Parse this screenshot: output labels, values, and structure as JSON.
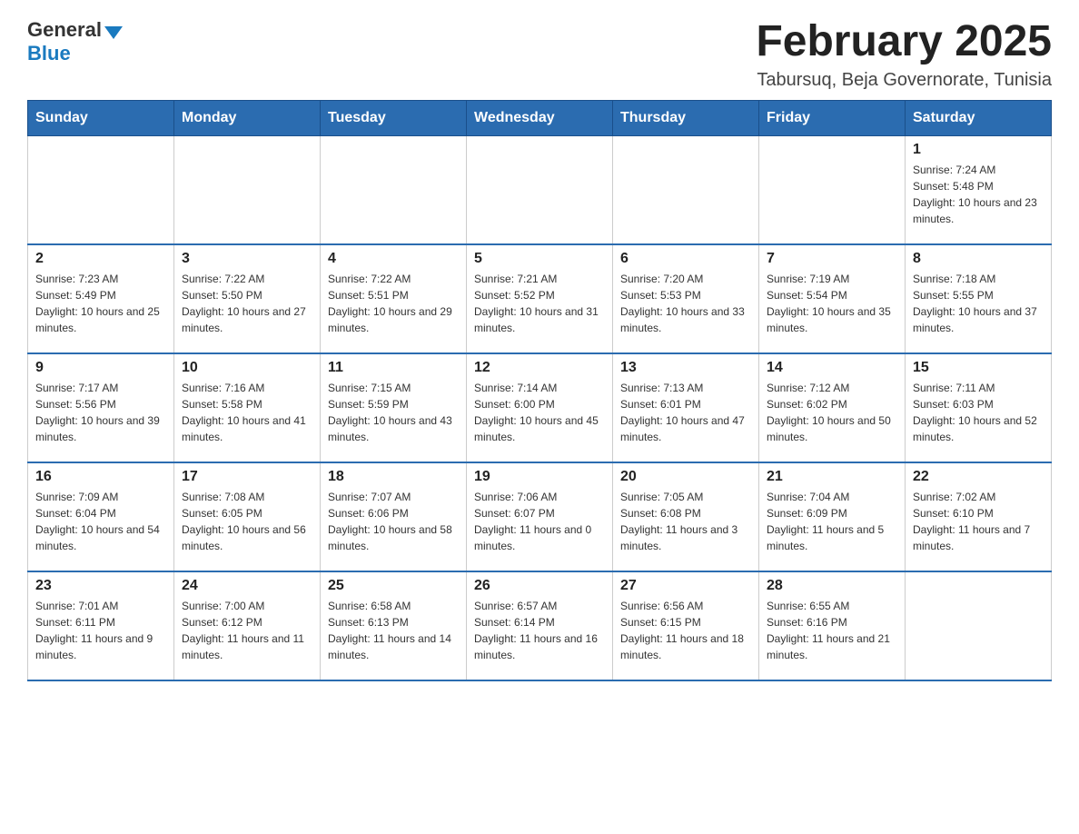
{
  "header": {
    "logo_general": "General",
    "logo_blue": "Blue",
    "month_title": "February 2025",
    "location": "Tabursuq, Beja Governorate, Tunisia"
  },
  "weekdays": [
    "Sunday",
    "Monday",
    "Tuesday",
    "Wednesday",
    "Thursday",
    "Friday",
    "Saturday"
  ],
  "weeks": [
    [
      {
        "day": "",
        "info": ""
      },
      {
        "day": "",
        "info": ""
      },
      {
        "day": "",
        "info": ""
      },
      {
        "day": "",
        "info": ""
      },
      {
        "day": "",
        "info": ""
      },
      {
        "day": "",
        "info": ""
      },
      {
        "day": "1",
        "info": "Sunrise: 7:24 AM\nSunset: 5:48 PM\nDaylight: 10 hours and 23 minutes."
      }
    ],
    [
      {
        "day": "2",
        "info": "Sunrise: 7:23 AM\nSunset: 5:49 PM\nDaylight: 10 hours and 25 minutes."
      },
      {
        "day": "3",
        "info": "Sunrise: 7:22 AM\nSunset: 5:50 PM\nDaylight: 10 hours and 27 minutes."
      },
      {
        "day": "4",
        "info": "Sunrise: 7:22 AM\nSunset: 5:51 PM\nDaylight: 10 hours and 29 minutes."
      },
      {
        "day": "5",
        "info": "Sunrise: 7:21 AM\nSunset: 5:52 PM\nDaylight: 10 hours and 31 minutes."
      },
      {
        "day": "6",
        "info": "Sunrise: 7:20 AM\nSunset: 5:53 PM\nDaylight: 10 hours and 33 minutes."
      },
      {
        "day": "7",
        "info": "Sunrise: 7:19 AM\nSunset: 5:54 PM\nDaylight: 10 hours and 35 minutes."
      },
      {
        "day": "8",
        "info": "Sunrise: 7:18 AM\nSunset: 5:55 PM\nDaylight: 10 hours and 37 minutes."
      }
    ],
    [
      {
        "day": "9",
        "info": "Sunrise: 7:17 AM\nSunset: 5:56 PM\nDaylight: 10 hours and 39 minutes."
      },
      {
        "day": "10",
        "info": "Sunrise: 7:16 AM\nSunset: 5:58 PM\nDaylight: 10 hours and 41 minutes."
      },
      {
        "day": "11",
        "info": "Sunrise: 7:15 AM\nSunset: 5:59 PM\nDaylight: 10 hours and 43 minutes."
      },
      {
        "day": "12",
        "info": "Sunrise: 7:14 AM\nSunset: 6:00 PM\nDaylight: 10 hours and 45 minutes."
      },
      {
        "day": "13",
        "info": "Sunrise: 7:13 AM\nSunset: 6:01 PM\nDaylight: 10 hours and 47 minutes."
      },
      {
        "day": "14",
        "info": "Sunrise: 7:12 AM\nSunset: 6:02 PM\nDaylight: 10 hours and 50 minutes."
      },
      {
        "day": "15",
        "info": "Sunrise: 7:11 AM\nSunset: 6:03 PM\nDaylight: 10 hours and 52 minutes."
      }
    ],
    [
      {
        "day": "16",
        "info": "Sunrise: 7:09 AM\nSunset: 6:04 PM\nDaylight: 10 hours and 54 minutes."
      },
      {
        "day": "17",
        "info": "Sunrise: 7:08 AM\nSunset: 6:05 PM\nDaylight: 10 hours and 56 minutes."
      },
      {
        "day": "18",
        "info": "Sunrise: 7:07 AM\nSunset: 6:06 PM\nDaylight: 10 hours and 58 minutes."
      },
      {
        "day": "19",
        "info": "Sunrise: 7:06 AM\nSunset: 6:07 PM\nDaylight: 11 hours and 0 minutes."
      },
      {
        "day": "20",
        "info": "Sunrise: 7:05 AM\nSunset: 6:08 PM\nDaylight: 11 hours and 3 minutes."
      },
      {
        "day": "21",
        "info": "Sunrise: 7:04 AM\nSunset: 6:09 PM\nDaylight: 11 hours and 5 minutes."
      },
      {
        "day": "22",
        "info": "Sunrise: 7:02 AM\nSunset: 6:10 PM\nDaylight: 11 hours and 7 minutes."
      }
    ],
    [
      {
        "day": "23",
        "info": "Sunrise: 7:01 AM\nSunset: 6:11 PM\nDaylight: 11 hours and 9 minutes."
      },
      {
        "day": "24",
        "info": "Sunrise: 7:00 AM\nSunset: 6:12 PM\nDaylight: 11 hours and 11 minutes."
      },
      {
        "day": "25",
        "info": "Sunrise: 6:58 AM\nSunset: 6:13 PM\nDaylight: 11 hours and 14 minutes."
      },
      {
        "day": "26",
        "info": "Sunrise: 6:57 AM\nSunset: 6:14 PM\nDaylight: 11 hours and 16 minutes."
      },
      {
        "day": "27",
        "info": "Sunrise: 6:56 AM\nSunset: 6:15 PM\nDaylight: 11 hours and 18 minutes."
      },
      {
        "day": "28",
        "info": "Sunrise: 6:55 AM\nSunset: 6:16 PM\nDaylight: 11 hours and 21 minutes."
      },
      {
        "day": "",
        "info": ""
      }
    ]
  ]
}
